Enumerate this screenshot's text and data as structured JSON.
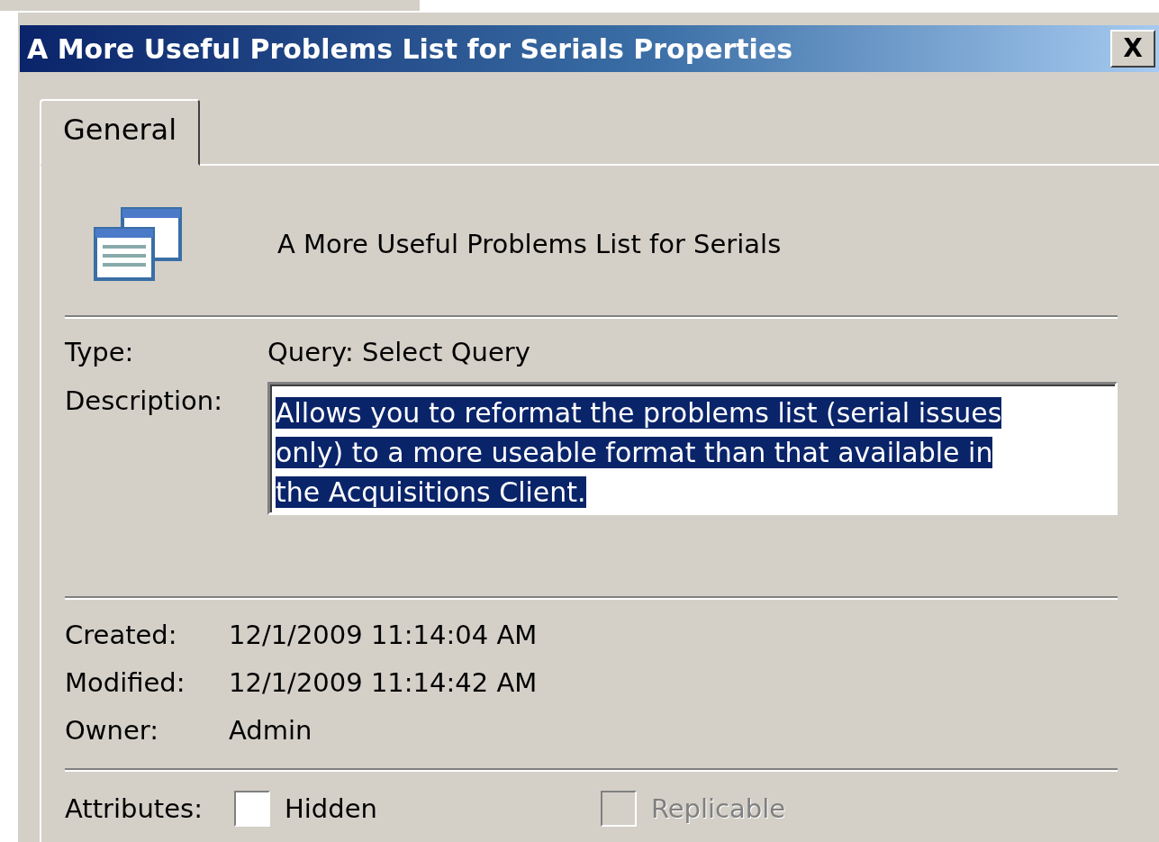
{
  "window": {
    "title": "A More Useful Problems List for Serials Properties",
    "close": "X"
  },
  "tabs": [
    {
      "label": "General",
      "selected": true
    }
  ],
  "object_name": "A More Useful Problems List for Serials",
  "type": {
    "label": "Type:",
    "value": "Query: Select Query"
  },
  "description": {
    "label": "Description:",
    "value": "Allows you to reformat the problems list (serial issues only) to a more useable format than that available in the Acquisitions Client.",
    "text_selected": true
  },
  "dates": [
    {
      "label": "Created:",
      "value": "12/1/2009 11:14:04 AM"
    },
    {
      "label": "Modified:",
      "value": "12/1/2009 11:14:42 AM"
    },
    {
      "label": "Owner:",
      "value": "Admin"
    }
  ],
  "attributes": {
    "label": "Attributes:",
    "options": [
      {
        "label": "Hidden",
        "checked": false,
        "disabled": false
      },
      {
        "label": "Replicable",
        "checked": false,
        "disabled": true
      }
    ]
  }
}
